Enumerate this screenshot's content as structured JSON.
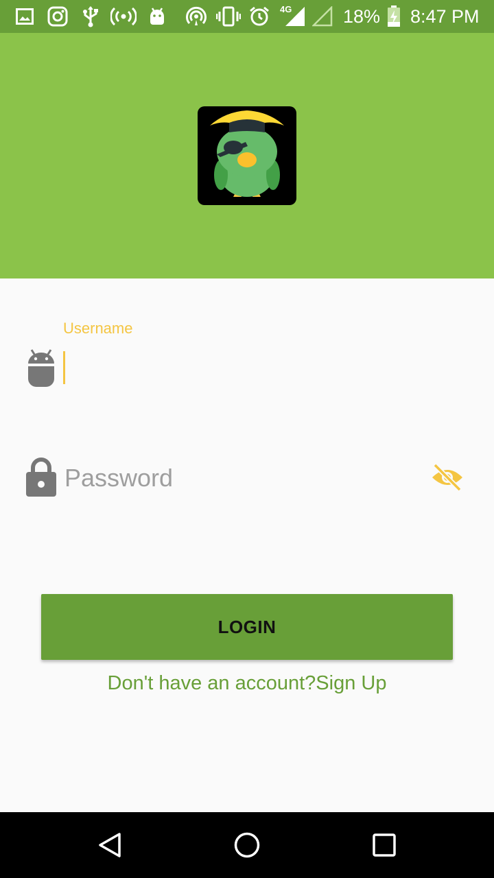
{
  "status_bar": {
    "battery": "18%",
    "time": "8:47 PM",
    "network": "4G",
    "icons": [
      "gallery-icon",
      "instagram-icon",
      "usb-icon",
      "hotspot-icon",
      "android-icon",
      "cast-icon",
      "vibrate-icon",
      "alarm-icon",
      "signal-icon",
      "signal-empty-icon",
      "battery-charging-icon"
    ]
  },
  "header": {
    "bg_color": "#8bc34a",
    "logo": "pirate-parrot-logo"
  },
  "form": {
    "username_label": "Username",
    "username_value": "",
    "password_placeholder": "Password",
    "accent_color": "#f4c542"
  },
  "login_button": {
    "label": "LOGIN",
    "color": "#689f38"
  },
  "signup_link": "Don't have an account?Sign Up",
  "nav_bar": {
    "icons": [
      "back-icon",
      "home-icon",
      "recents-icon"
    ]
  }
}
